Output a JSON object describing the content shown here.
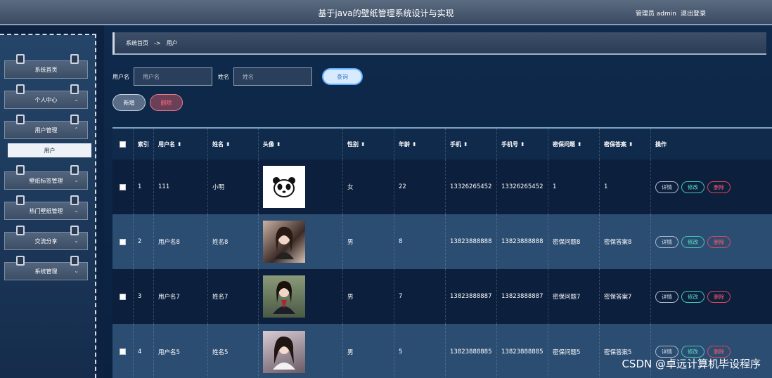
{
  "header": {
    "title": "基于java的壁纸管理系统设计与实现",
    "role_user": "管理员 admin",
    "logout": "退出登录"
  },
  "sidebar": {
    "items": [
      {
        "label": "系统首页"
      },
      {
        "label": "个人中心"
      },
      {
        "label": "用户管理"
      },
      {
        "label": "壁纸标签管理"
      },
      {
        "label": "热门壁纸管理"
      },
      {
        "label": "交流分享"
      },
      {
        "label": "系统管理"
      }
    ],
    "submenu_active": "用户"
  },
  "breadcrumb": {
    "home": "系统首页",
    "separator": "->",
    "current": "用户"
  },
  "search": {
    "username_label": "用户名",
    "username_placeholder": "用户名",
    "name_label": "姓名",
    "name_placeholder": "姓名",
    "query_button": "查询"
  },
  "actions": {
    "add": "新增",
    "delete": "删除"
  },
  "table": {
    "headers": {
      "index": "索引",
      "username": "用户名 ⬍",
      "name": "姓名 ⬍",
      "avatar": "头像 ⬍",
      "sex": "性别 ⬍",
      "age": "年龄 ⬍",
      "phone": "手机 ⬍",
      "mobile": "手机号 ⬍",
      "question": "密保问题 ⬍",
      "answer": "密保答案 ⬍",
      "ops": "操作"
    },
    "rows": [
      {
        "index": "1",
        "username": "111",
        "name": "小明",
        "sex": "女",
        "age": "22",
        "phone": "13326265452",
        "mobile": "13326265452",
        "question": "1",
        "answer": "1",
        "avatar": "panda-avatar"
      },
      {
        "index": "2",
        "username": "用户名8",
        "name": "姓名8",
        "sex": "男",
        "age": "8",
        "phone": "13823888888",
        "mobile": "13823888888",
        "question": "密保问题8",
        "answer": "密保答案8",
        "avatar": "photo-avatar"
      },
      {
        "index": "3",
        "username": "用户名7",
        "name": "姓名7",
        "sex": "男",
        "age": "7",
        "phone": "13823888887",
        "mobile": "13823888887",
        "question": "密保问题7",
        "answer": "密保答案7",
        "avatar": "photo-avatar"
      },
      {
        "index": "4",
        "username": "用户名5",
        "name": "姓名5",
        "sex": "男",
        "age": "5",
        "phone": "13823888885",
        "mobile": "13823888885",
        "question": "密保问题5",
        "answer": "密保答案5",
        "avatar": "photo-avatar"
      }
    ],
    "op_labels": {
      "detail": "详情",
      "edit": "修改",
      "remove": "删除"
    }
  },
  "watermark": "CSDN @卓远计算机毕设程序",
  "colors": {
    "accent": "#5fb0ff",
    "danger": "#ff5a6a",
    "success": "#5ee0c8"
  }
}
